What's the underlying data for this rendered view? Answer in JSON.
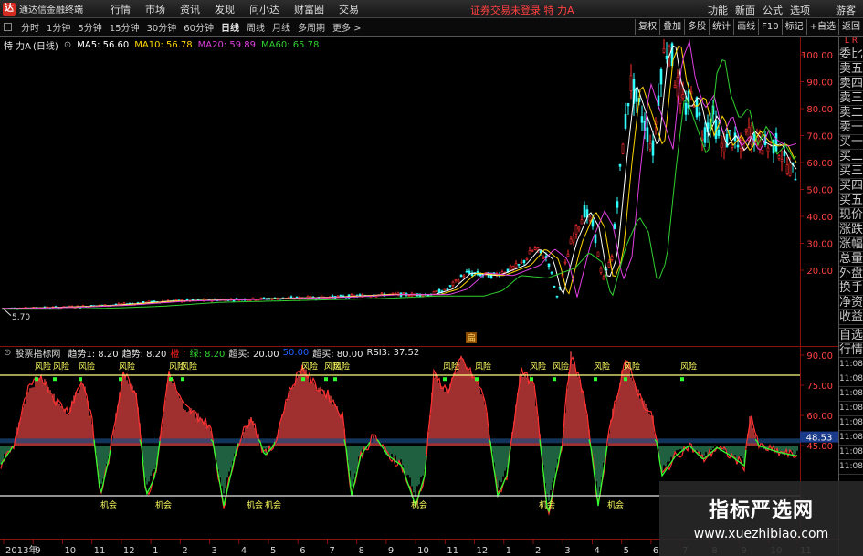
{
  "app": {
    "logo": "达",
    "title": "通达信金融终端"
  },
  "menu": [
    "行情",
    "市场",
    "资讯",
    "发现",
    "问小达",
    "财富圈",
    "交易"
  ],
  "trade_alert": "证券交易未登录  特 力A",
  "right_menu": [
    "功能",
    "新面",
    "公式",
    "选项"
  ],
  "guest": "游客",
  "toolbar": {
    "periods": [
      "分时",
      "1分钟",
      "5分钟",
      "15分钟",
      "30分钟",
      "60分钟",
      "日线",
      "周线",
      "月线",
      "多周期",
      "更多 >"
    ],
    "active_period": "日线",
    "right_buttons": [
      "复权",
      "叠加",
      "多股",
      "统计",
      "画线",
      "F10",
      "标记",
      "+自选",
      "返回"
    ]
  },
  "stock": {
    "name": "特 力A",
    "period_tag": "(日线)",
    "ma": [
      {
        "label": "MA5: 56.60",
        "color": "#ffffff"
      },
      {
        "label": "MA10: 56.78",
        "color": "#ffd700"
      },
      {
        "label": "MA20: 59.89",
        "color": "#e040e0"
      },
      {
        "label": "MA60: 65.78",
        "color": "#30d030"
      }
    ]
  },
  "main_axis": {
    "ticks": [
      "100.00",
      "90.00",
      "80.00",
      "70.00",
      "60.00",
      "50.00",
      "40.00",
      "30.00",
      "20.00"
    ],
    "high_label": "108.00",
    "low_label": "5.70",
    "marker": "扁"
  },
  "indicator": {
    "name": "股票指标网",
    "items": [
      {
        "label": "趋势1: 8.20",
        "color": "#e8e8e8"
      },
      {
        "label": "趋势: 8.20",
        "color": "#e8e8e8"
      },
      {
        "label": "橙",
        "color": "#ff2020"
      },
      {
        "label": "·",
        "color": "#ff2020"
      },
      {
        "label": "绿: 8.20",
        "color": "#30d030"
      },
      {
        "label": "超买: 20.00",
        "color": "#e8e8e8"
      },
      {
        "label": "50.00",
        "color": "#2060ff"
      },
      {
        "label": "超买: 80.00",
        "color": "#e8e8e8"
      },
      {
        "label": "RSI3: 37.52",
        "color": "#e8e8e8"
      }
    ],
    "axis_ticks": [
      "90.00",
      "75.00",
      "60.00",
      "45.00"
    ],
    "current_value": "48.53",
    "risk_label": "风险",
    "chance_label": "机会"
  },
  "time_axis": [
    "2013年",
    "9",
    "10",
    "11",
    "12",
    "1",
    "2",
    "3",
    "4",
    "5",
    "6",
    "7",
    "8",
    "9",
    "10",
    "11",
    "12",
    "1",
    "2",
    "3",
    "4",
    "5",
    "6",
    "7",
    "8",
    "9",
    "10",
    "11"
  ],
  "side_tabs": {
    "header": "L R",
    "top": [
      "委比",
      "卖五",
      "卖四",
      "卖三",
      "卖二",
      "卖一",
      "买一",
      "买二",
      "买三",
      "买四",
      "买五",
      "现价",
      "涨跌",
      "涨幅",
      "总量",
      "外盘",
      "换手",
      "净资",
      "收益"
    ],
    "bottom": [
      "自选",
      "行情",
      "11:08",
      "11:08",
      "11:08",
      "11:08",
      "11:08",
      "11:08",
      "11:08",
      "11:08"
    ]
  },
  "watermark": {
    "title": "指标严选网",
    "url": "www.xuezhibiao.com"
  },
  "colors": {
    "up": "#ff3030",
    "down": "#30ff30",
    "line_ma5": "#ffffff",
    "line_ma10": "#ffd700",
    "line_ma20": "#e040e0",
    "line_ma60": "#30d030"
  }
}
